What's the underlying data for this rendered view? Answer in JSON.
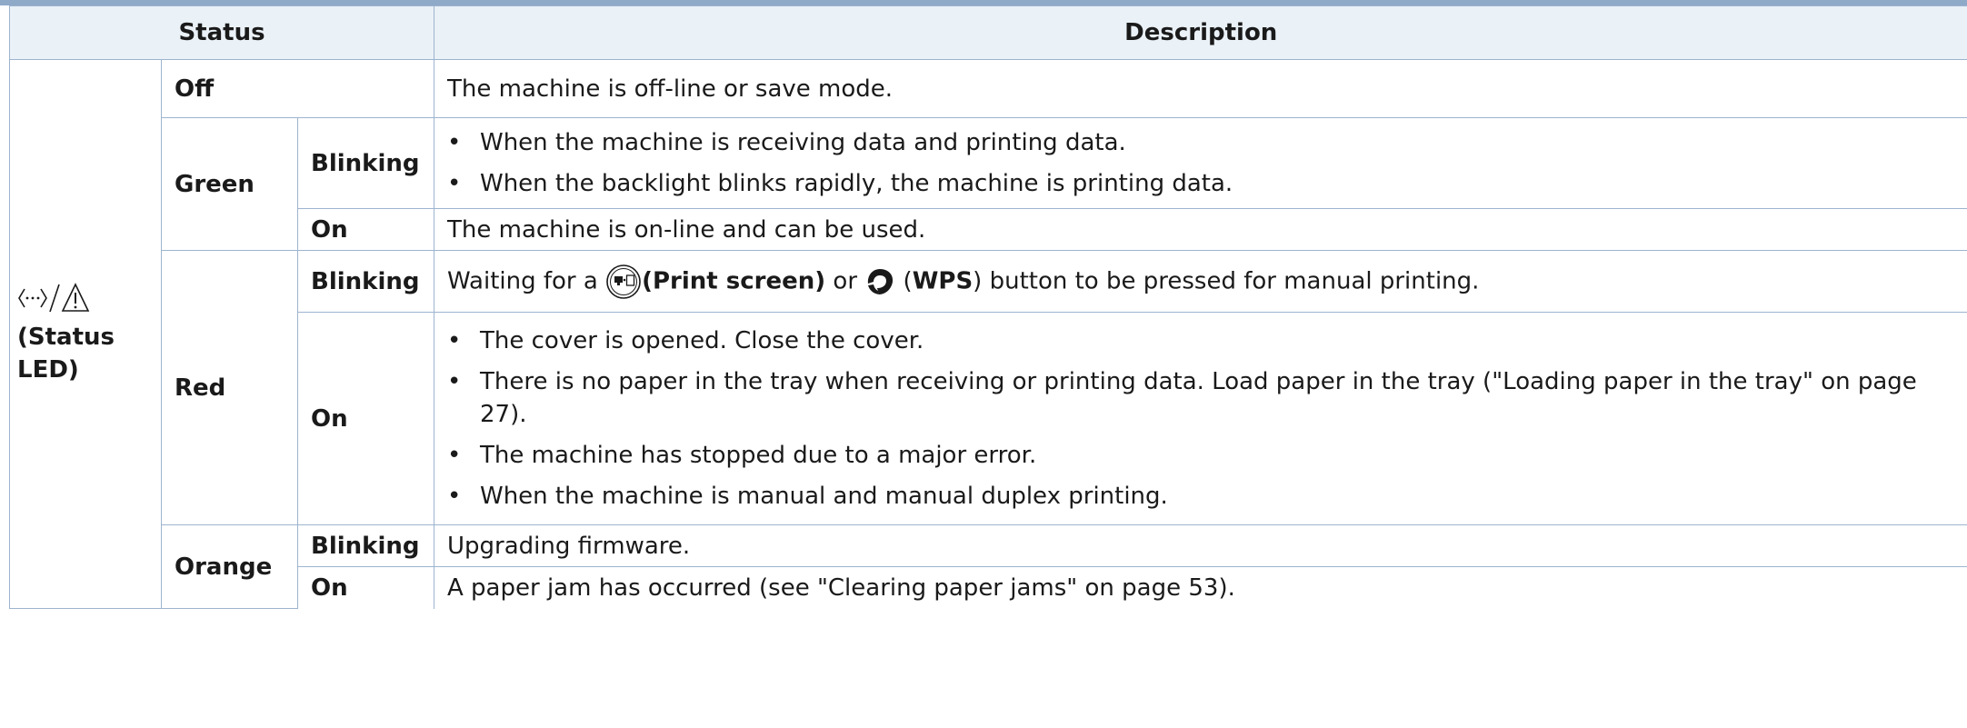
{
  "header": {
    "status": "Status",
    "description": "Description"
  },
  "status_led": {
    "icon_names": [
      "wifi-led-icon",
      "warning-triangle-icon"
    ],
    "label": "(Status LED)"
  },
  "rows": {
    "off": {
      "state": "Off",
      "desc": "The machine is off-line or save mode."
    },
    "green": {
      "color": "Green",
      "blinking": {
        "mode": "Blinking",
        "bullets": [
          "When the machine is receiving data and printing data.",
          "When the backlight blinks rapidly, the machine is printing data."
        ]
      },
      "on": {
        "mode": "On",
        "desc": "The machine is on-line and can be used."
      }
    },
    "red": {
      "color": "Red",
      "blinking": {
        "mode": "Blinking",
        "desc_prefix": "Waiting for a",
        "print_screen": "(Print screen)",
        "or": "or",
        "wps_open": "(",
        "wps": "WPS",
        "desc_suffix": ") button to be pressed for manual printing."
      },
      "on": {
        "mode": "On",
        "bullets": [
          "The cover is opened. Close the cover.",
          "There is no paper in the tray when receiving or printing data. Load paper in the tray (\"Loading paper in the tray\" on page 27).",
          "The machine has stopped due to a major error.",
          "When the machine is manual and manual duplex printing."
        ]
      }
    },
    "orange": {
      "color": "Orange",
      "blinking": {
        "mode": "Blinking",
        "desc": "Upgrading firmware."
      },
      "on": {
        "mode": "On",
        "desc": "A paper jam has occurred (see \"Clearing paper jams\" on page 53)."
      }
    }
  },
  "bullet_char": "•",
  "colors": {
    "border": "#9db4cf",
    "header_bg": "#eaf1f7",
    "top_bar": "#8fa9c8"
  }
}
